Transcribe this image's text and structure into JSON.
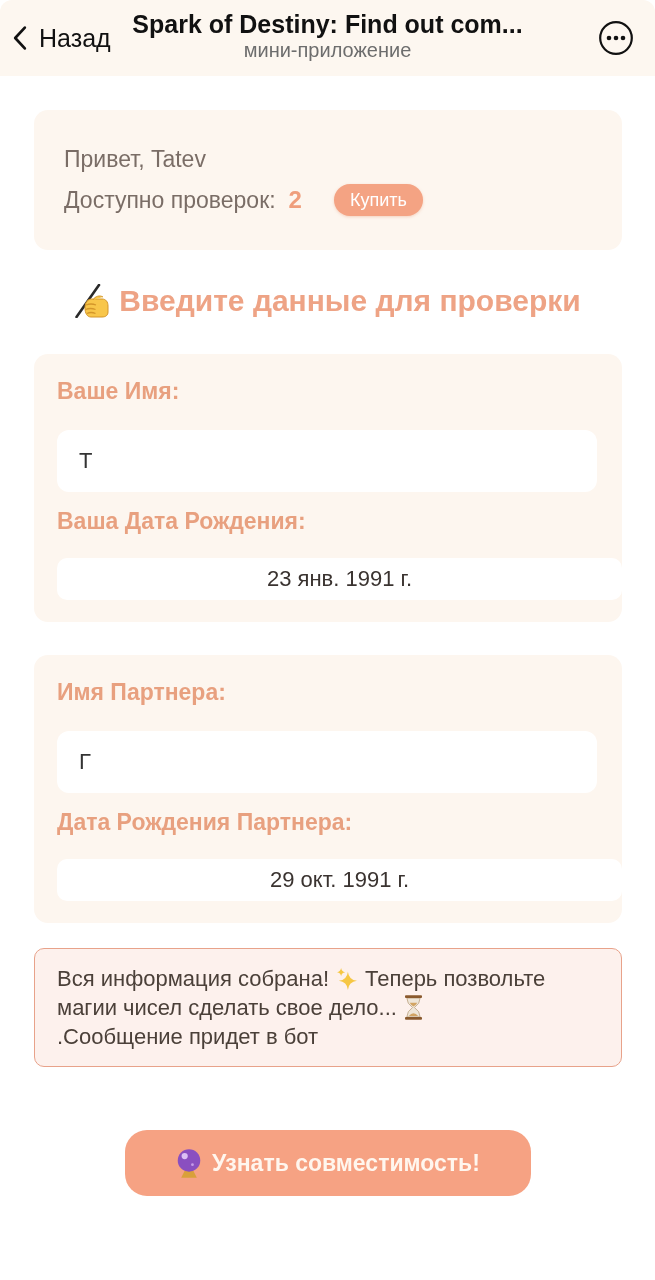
{
  "header": {
    "back": "Назад",
    "title": "Spark of Destiny: Find out com...",
    "subtitle": "мини-приложение"
  },
  "account": {
    "greeting": "Привет, Tatev",
    "checks_label": "Доступно проверок:",
    "checks_count": "2",
    "buy_button": "Купить"
  },
  "heading": "Введите данные для проверки",
  "forms": [
    {
      "name_label": "Ваше Имя:",
      "name_value": "T",
      "date_label": "Ваша Дата Рождения:",
      "date_value": "23 янв. 1991 г."
    },
    {
      "name_label": "Имя Партнера:",
      "name_value": "Г",
      "date_label": "Дата Рождения Партнера:",
      "date_value": "29 окт. 1991 г."
    }
  ],
  "notice": {
    "segments": [
      "Вся информация собрана!",
      "Теперь позвольте",
      "магии чисел сделать свое дело...",
      ".Сообщение придет в бот"
    ]
  },
  "submit_button": "Узнать совместимость!"
}
